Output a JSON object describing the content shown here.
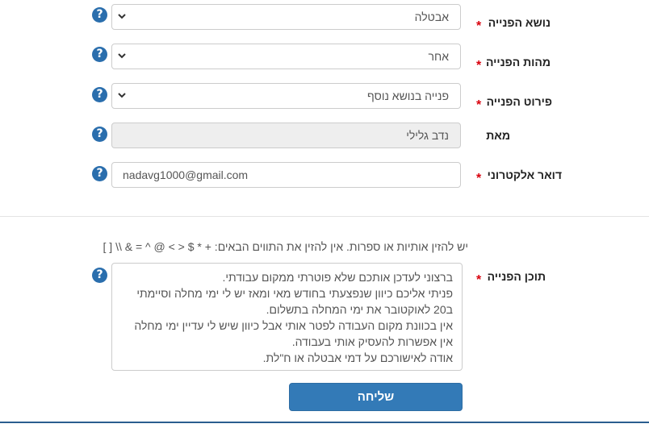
{
  "fields": {
    "subject": {
      "label": "נושא הפנייה",
      "value": "אבטלה"
    },
    "nature": {
      "label": "מהות הפנייה",
      "value": "אחר"
    },
    "detail": {
      "label": "פירוט הפנייה",
      "value": "פנייה בנושא נוסף"
    },
    "from": {
      "label": "מאת",
      "value": "נדב גלילי"
    },
    "email": {
      "label": "דואר אלקטרוני",
      "value": "nadavg1000@gmail.com"
    }
  },
  "required_mark": "*",
  "help_symbol": "?",
  "hint": "יש להזין אותיות או ספרות. אין להזין את התווים הבאים: + * $ < > @ ^ = & \\\\ [ ]",
  "content": {
    "label": "תוכן הפנייה",
    "lines": [
      "ברצוני לעדכן אותכם שלא פוטרתי ממקום עבודתי.",
      "פניתי אליכם כיוון שנפצעתי בחודש מאי ומאז יש לי ימי מחלה וסיימתי",
      "ב20 לאוקטובר את ימי המחלה בתשלום.",
      "אין בכוונת מקום העבודה לפטר אותי אבל כיוון שיש לי עדיין ימי מחלה",
      "אין אפשרות להעסיק אותי בעבודה.",
      "אודה לאישורכם על דמי אבטלה או ח\"לת."
    ]
  },
  "submit_label": "שליחה",
  "colors": {
    "accent": "#337ab7",
    "help": "#2a6ead",
    "required": "#d9000d"
  }
}
